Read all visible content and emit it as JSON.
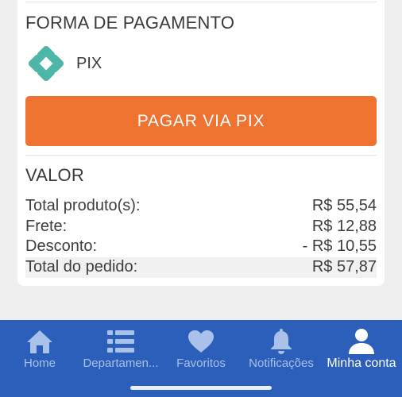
{
  "payment": {
    "title": "FORMA DE PAGAMENTO",
    "method_label": "PIX",
    "method_icon": "pix-icon",
    "button_label": "PAGAR VIA PIX",
    "button_color": "#ef7230"
  },
  "summary": {
    "title": "VALOR",
    "rows": [
      {
        "label": "Total produto(s):",
        "value": "R$ 55,54"
      },
      {
        "label": "Frete:",
        "value": "R$ 12,88"
      },
      {
        "label": "Desconto:",
        "value": "- R$ 10,55"
      },
      {
        "label": "Total do pedido:",
        "value": "R$ 57,87"
      }
    ]
  },
  "nav": {
    "background": "#2b5fba",
    "items": [
      {
        "label": "Home",
        "icon": "home-icon",
        "active": false
      },
      {
        "label": "Departamen...",
        "icon": "list-icon",
        "active": false
      },
      {
        "label": "Favoritos",
        "icon": "heart-icon",
        "active": false
      },
      {
        "label": "Notificações",
        "icon": "bell-icon",
        "active": false
      },
      {
        "label": "Minha conta",
        "icon": "user-icon",
        "active": true
      }
    ]
  }
}
